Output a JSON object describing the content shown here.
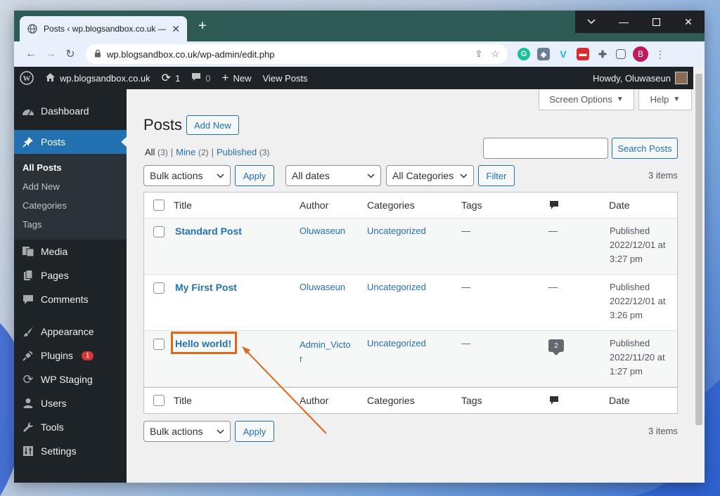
{
  "browser": {
    "tab_title": "Posts ‹ wp.blogsandbox.co.uk —",
    "url": "wp.blogsandbox.co.uk/wp-admin/edit.php",
    "profile_initial": "B"
  },
  "adminbar": {
    "site_name": "wp.blogsandbox.co.uk",
    "updates_count": "1",
    "comments_count": "0",
    "new_label": "New",
    "view_posts_label": "View Posts",
    "howdy": "Howdy, Oluwaseun"
  },
  "sidebar": {
    "items": [
      {
        "label": "Dashboard",
        "icon": "dashboard-icon"
      },
      {
        "label": "Posts",
        "icon": "pin-icon"
      },
      {
        "label": "Media",
        "icon": "media-icon"
      },
      {
        "label": "Pages",
        "icon": "pages-icon"
      },
      {
        "label": "Comments",
        "icon": "comment-icon"
      },
      {
        "label": "Appearance",
        "icon": "brush-icon"
      },
      {
        "label": "Plugins",
        "icon": "plug-icon",
        "badge": "1"
      },
      {
        "label": "WP Staging",
        "icon": "refresh-icon"
      },
      {
        "label": "Users",
        "icon": "user-icon"
      },
      {
        "label": "Tools",
        "icon": "wrench-icon"
      },
      {
        "label": "Settings",
        "icon": "settings-icon"
      }
    ],
    "posts_submenu": [
      "All Posts",
      "Add New",
      "Categories",
      "Tags"
    ]
  },
  "content": {
    "screen_options": "Screen Options",
    "help": "Help",
    "page_title": "Posts",
    "add_new": "Add New",
    "filters": {
      "all": "All",
      "all_count": "(3)",
      "mine": "Mine",
      "mine_count": "(2)",
      "published": "Published",
      "published_count": "(3)",
      "sep": "|"
    },
    "search_button": "Search Posts",
    "bulk_actions": "Bulk actions",
    "apply": "Apply",
    "all_dates": "All dates",
    "all_categories": "All Categories",
    "filter": "Filter",
    "items_count": "3 items"
  },
  "table": {
    "columns": {
      "title": "Title",
      "author": "Author",
      "categories": "Categories",
      "tags": "Tags",
      "date": "Date"
    },
    "rows": [
      {
        "title": "Standard Post",
        "author": "Oluwaseun",
        "category": "Uncategorized",
        "tags": "—",
        "comments": "—",
        "status": "Published",
        "date": "2022/12/01 at",
        "time": "3:27 pm"
      },
      {
        "title": "My First Post",
        "author": "Oluwaseun",
        "category": "Uncategorized",
        "tags": "—",
        "comments": "—",
        "status": "Published",
        "date": "2022/12/01 at",
        "time": "3:26 pm"
      },
      {
        "title": "Hello world!",
        "author": "Admin_Victo",
        "author_wrap": "r",
        "category": "Uncategorized",
        "tags": "—",
        "comments": "2",
        "status": "Published",
        "date": "2022/11/20 at",
        "time": "1:27 pm"
      }
    ]
  },
  "colors": {
    "wp_blue": "#2271b1",
    "admin_dark": "#1d2327",
    "annotation": "#e0661a"
  }
}
